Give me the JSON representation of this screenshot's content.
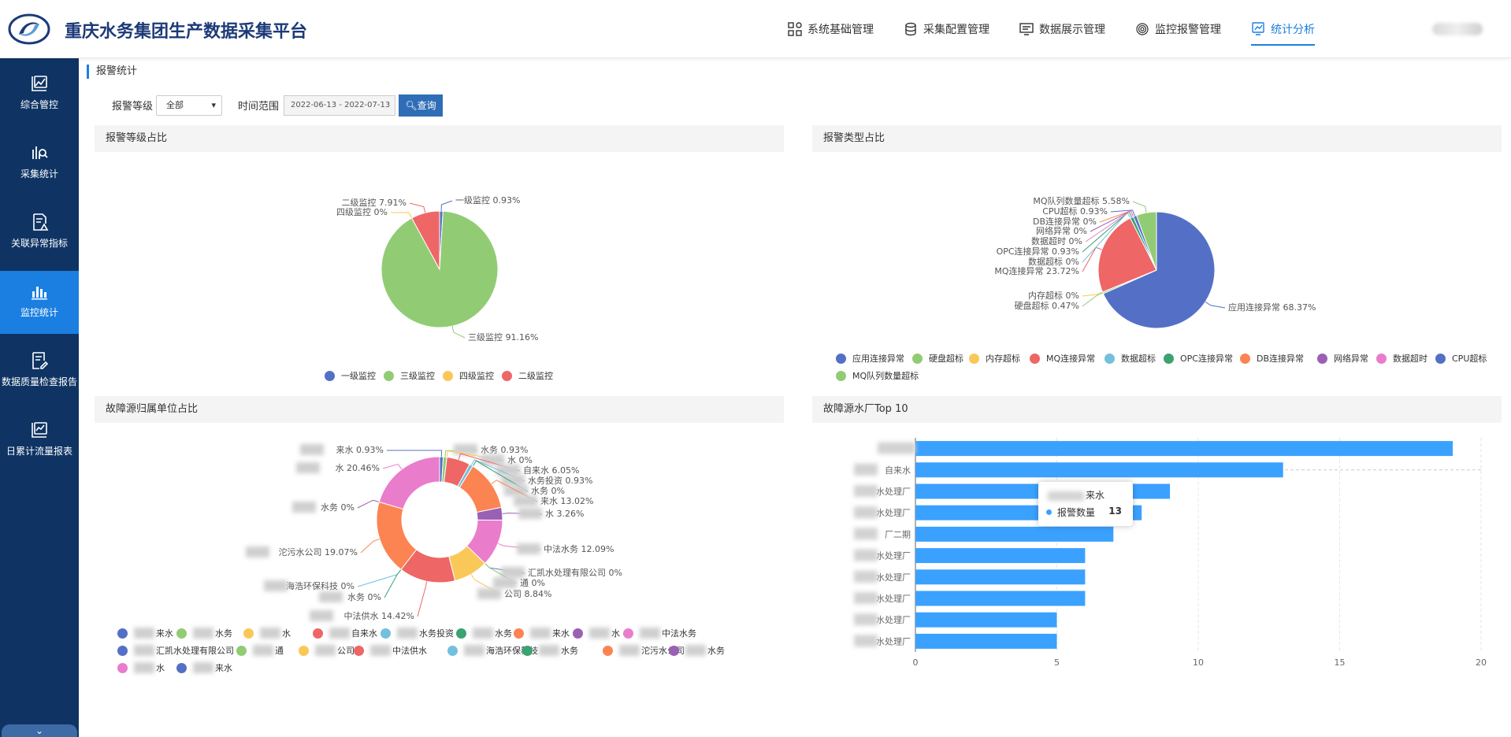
{
  "header": {
    "title": "重庆水务集团生产数据采集平台",
    "nav": [
      {
        "label": "系统基础管理",
        "icon": "grid-apps-icon"
      },
      {
        "label": "采集配置管理",
        "icon": "database-icon"
      },
      {
        "label": "数据展示管理",
        "icon": "monitor-list-icon"
      },
      {
        "label": "监控报警管理",
        "icon": "fingerprint-icon"
      },
      {
        "label": "统计分析",
        "icon": "analysis-screen-icon",
        "active": true
      }
    ]
  },
  "sidebar": {
    "items": [
      {
        "label": "综合管控",
        "icon": "line-chart-icon"
      },
      {
        "label": "采集统计",
        "icon": "data-search-icon"
      },
      {
        "label": "关联异常指标",
        "icon": "doc-warning-icon"
      },
      {
        "label": "监控统计",
        "icon": "bar-chart-icon",
        "active": true
      },
      {
        "label": "数据质量检查报告",
        "icon": "report-edit-icon"
      },
      {
        "label": "日累计流量报表",
        "icon": "chart-report-icon"
      }
    ],
    "collapse_icon": "chevron-down-icon"
  },
  "page": {
    "breadcrumb": "报警统计",
    "filter": {
      "level_label": "报警等级",
      "level_value": "全部",
      "range_label": "时间范围",
      "range_value": "2022-06-13 - 2022-07-13",
      "query_label": "查询"
    }
  },
  "panels": {
    "level": {
      "title": "报警等级占比"
    },
    "type": {
      "title": "报警类型占比"
    },
    "unit": {
      "title": "故障源归属单位占比"
    },
    "top10": {
      "title": "故障源水厂Top 10"
    }
  },
  "chart_data": [
    {
      "type": "pie",
      "title": "报警等级占比",
      "labels": [
        "一级监控",
        "三级监控",
        "四级监控",
        "二级监控"
      ],
      "values": [
        0.93,
        91.16,
        0,
        7.91
      ],
      "unit": "%",
      "colors": [
        "#5470c6",
        "#91cc75",
        "#fac858",
        "#ee6666"
      ],
      "legend": "bottom"
    },
    {
      "type": "pie",
      "title": "报警类型占比",
      "labels": [
        "应用连接异常",
        "硬盘超标",
        "内存超标",
        "MQ连接异常",
        "数据超标",
        "OPC连接异常",
        "DB连接异常",
        "网络异常",
        "数据超时",
        "CPU超标",
        "MQ队列数量超标"
      ],
      "values": [
        68.37,
        0.47,
        0,
        23.72,
        0,
        0.93,
        0,
        0,
        0,
        0.93,
        5.58
      ],
      "unit": "%",
      "colors": [
        "#5470c6",
        "#91cc75",
        "#fac858",
        "#ee6666",
        "#73c0de",
        "#3ba272",
        "#fc8452",
        "#9a60b4",
        "#ea7ccc",
        "#5470c6",
        "#91cc75"
      ],
      "legend": "bottom"
    },
    {
      "type": "pie",
      "subtype": "donut",
      "title": "故障源归属单位占比",
      "labels": [
        "来水",
        "水务",
        "水",
        "自来水",
        "水务投资",
        "水务",
        "来水",
        "水",
        "中法水务",
        "汇凯水处理有限公司",
        "通",
        "公司",
        "中法供水",
        "海浩环保科技",
        "水务",
        "沱污水公司",
        "水务",
        "水"
      ],
      "values": [
        0.93,
        0.93,
        0,
        6.05,
        0.93,
        0,
        13.02,
        3.26,
        12.09,
        0,
        0,
        8.84,
        14.42,
        0,
        0,
        19.07,
        0,
        20.46
      ],
      "unit": "%",
      "colors": [
        "#5470c6",
        "#91cc75",
        "#fac858",
        "#ee6666",
        "#73c0de",
        "#3ba272",
        "#fc8452",
        "#9a60b4",
        "#ea7ccc",
        "#5470c6",
        "#91cc75",
        "#fac858",
        "#ee6666",
        "#73c0de",
        "#3ba272",
        "#fc8452",
        "#9a60b4",
        "#ea7ccc"
      ],
      "legend": "bottom"
    },
    {
      "type": "bar",
      "orientation": "horizontal",
      "title": "故障源水厂Top 10",
      "categories": [
        "",
        "自来水",
        "水处理厂",
        "水处理厂",
        "厂二期",
        "水处理厂",
        "水处理厂",
        "水处理厂",
        "水处理厂",
        "水处理厂"
      ],
      "values": [
        19,
        13,
        9,
        8,
        7,
        6,
        6,
        6,
        5,
        5
      ],
      "xlim": [
        0,
        20
      ],
      "xticks": [
        "0",
        "5",
        "10",
        "15",
        "20"
      ],
      "color": "#3aa1ff",
      "tooltip": {
        "name": "来水",
        "series": "报警数量",
        "value": "13"
      }
    }
  ]
}
